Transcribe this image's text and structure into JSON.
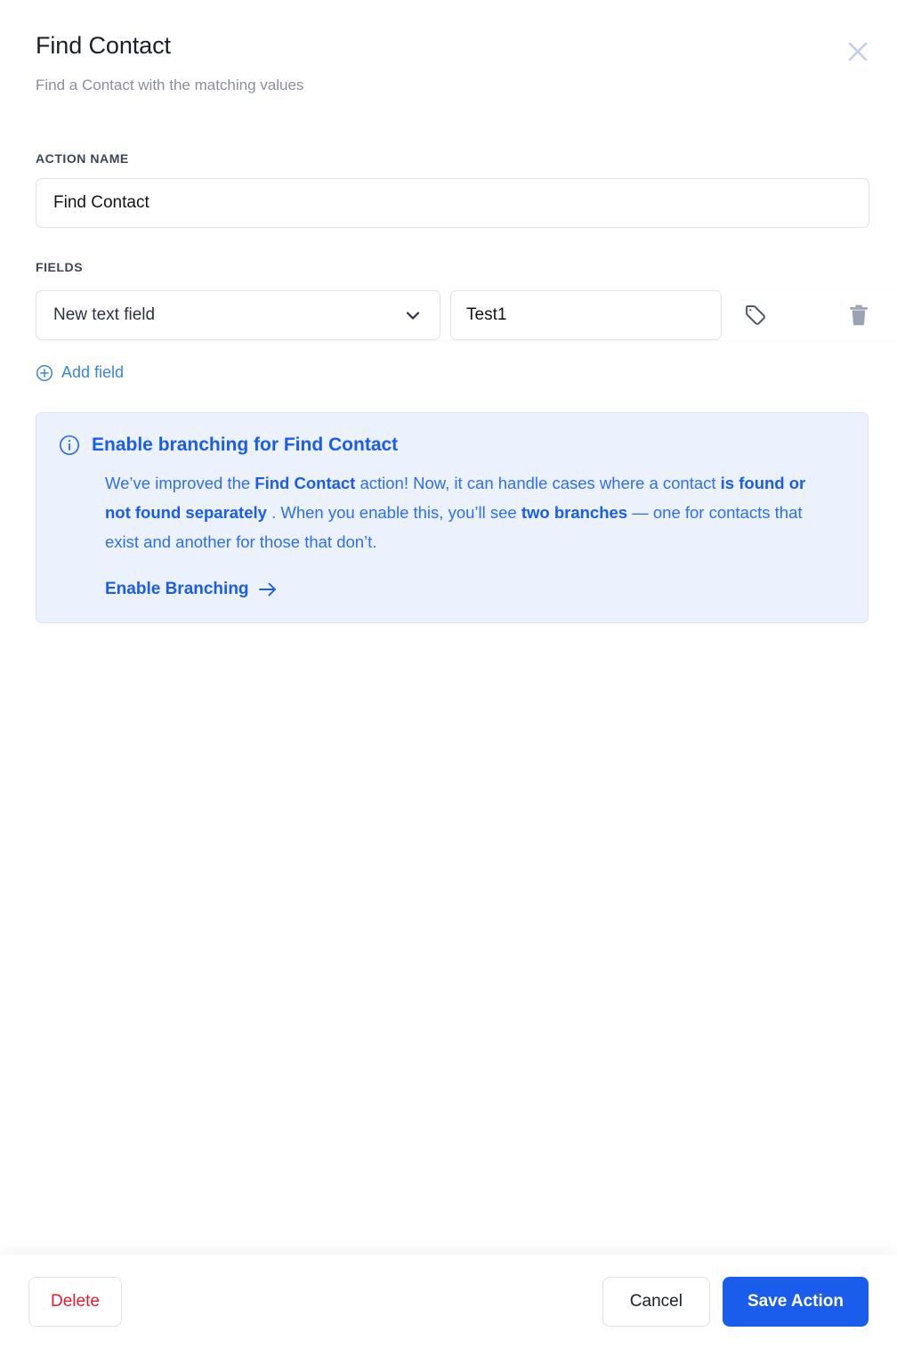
{
  "header": {
    "title": "Find Contact",
    "subtitle": "Find a Contact with the matching values",
    "close_icon": "close-icon"
  },
  "form": {
    "action_name_label": "ACTION NAME",
    "action_name_value": "Find Contact",
    "action_name_placeholder": "Action name",
    "fields_label": "FIELDS",
    "rows": [
      {
        "field_name": "New text field",
        "field_value": "Test1",
        "value_placeholder": "Value",
        "tag_icon": "tag-icon",
        "delete_icon": "trash-icon",
        "chevron_icon": "chevron-down-icon"
      }
    ],
    "add_field_label": "Add field",
    "add_field_icon": "plus-circle-icon"
  },
  "banner": {
    "info_icon": "info-circle-icon",
    "title": "Enable branching for Find Contact",
    "body": {
      "part1": "We’ve improved the ",
      "strong1": "Find Contact",
      "part2": " action! Now, it can handle cases where a contact ",
      "strong2": "is found or not found separately",
      "part3": " . When you enable this, you’ll see ",
      "strong3": "two branches",
      "part4": " — one for contacts that exist and another for those that don’t."
    },
    "cta_label": "Enable Branching",
    "cta_icon": "arrow-right-icon",
    "background_color": "#ebf2fd",
    "accent_color": "#1a5ceb"
  },
  "footer": {
    "delete_label": "Delete",
    "cancel_label": "Cancel",
    "save_label": "Save Action",
    "delete_color": "#e8192c",
    "save_color": "#1a5ceb"
  }
}
